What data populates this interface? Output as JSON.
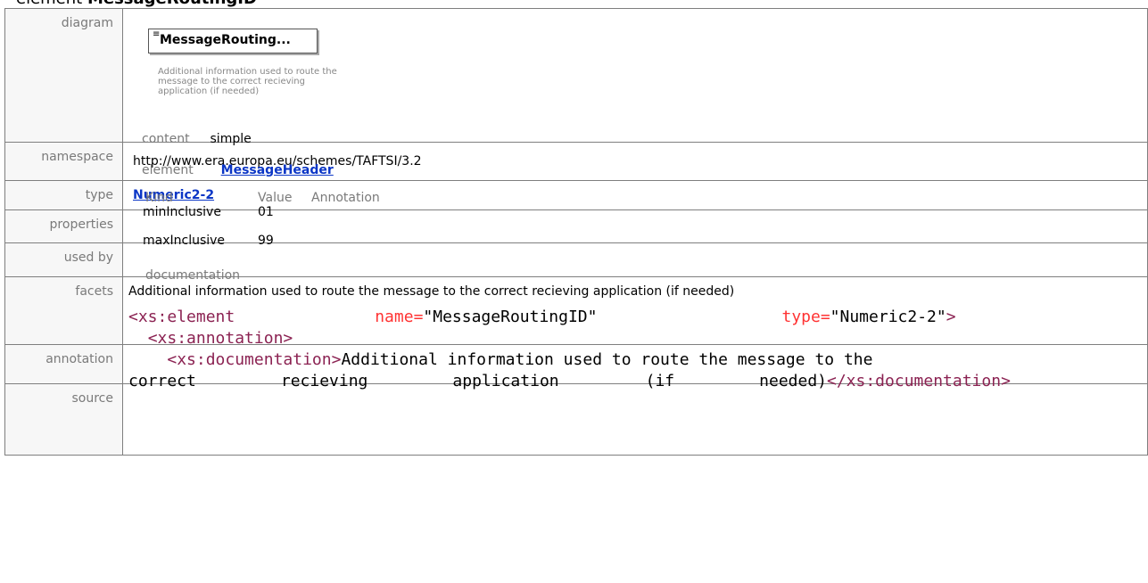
{
  "header": {
    "prefix": "element",
    "name": "MessageRoutingID"
  },
  "rows": {
    "diagram_label": "diagram",
    "namespace_label": "namespace",
    "type_label": "type",
    "properties_label": "properties",
    "usedby_label": "used by",
    "facets_label": "facets",
    "annotation_label": "annotation",
    "source_label": "source"
  },
  "diagram": {
    "box_label": "MessageRouting...",
    "note": "Additional information used to route the message to the correct recieving application (if needed)"
  },
  "namespace": "http://www.era.europa.eu/schemes/TAFTSI/3.2",
  "type": "Numeric2-2",
  "properties": {
    "key": "content",
    "value": "simple"
  },
  "used_by": {
    "key": "element",
    "value": "MessageHeader"
  },
  "facets": {
    "headers": [
      "Kind",
      "Value",
      "Annotation"
    ],
    "rows": [
      {
        "kind": "minInclusive",
        "value": "01"
      },
      {
        "kind": "maxInclusive",
        "value": "99"
      }
    ]
  },
  "annotation": {
    "key": "documentation",
    "text": "Additional information used to route the message to the correct recieving application (if needed)"
  },
  "source": {
    "l1_tag": "<xs:element",
    "l1_attr1": "name=",
    "l1_val1": "\"MessageRoutingID\"",
    "l1_attr2": "type=",
    "l1_val2": "\"Numeric2-2\"",
    "l1_close": ">",
    "l2_tag": "<xs:annotation>",
    "l3_tag": "<xs:documentation>",
    "l3_text": "Additional information used to route the message to the",
    "l4_w1": "correct",
    "l4_w2": "recieving",
    "l4_w3": "application",
    "l4_w4": "(if",
    "l4_w5": "needed)",
    "l4_close": "</xs:documentation>"
  }
}
